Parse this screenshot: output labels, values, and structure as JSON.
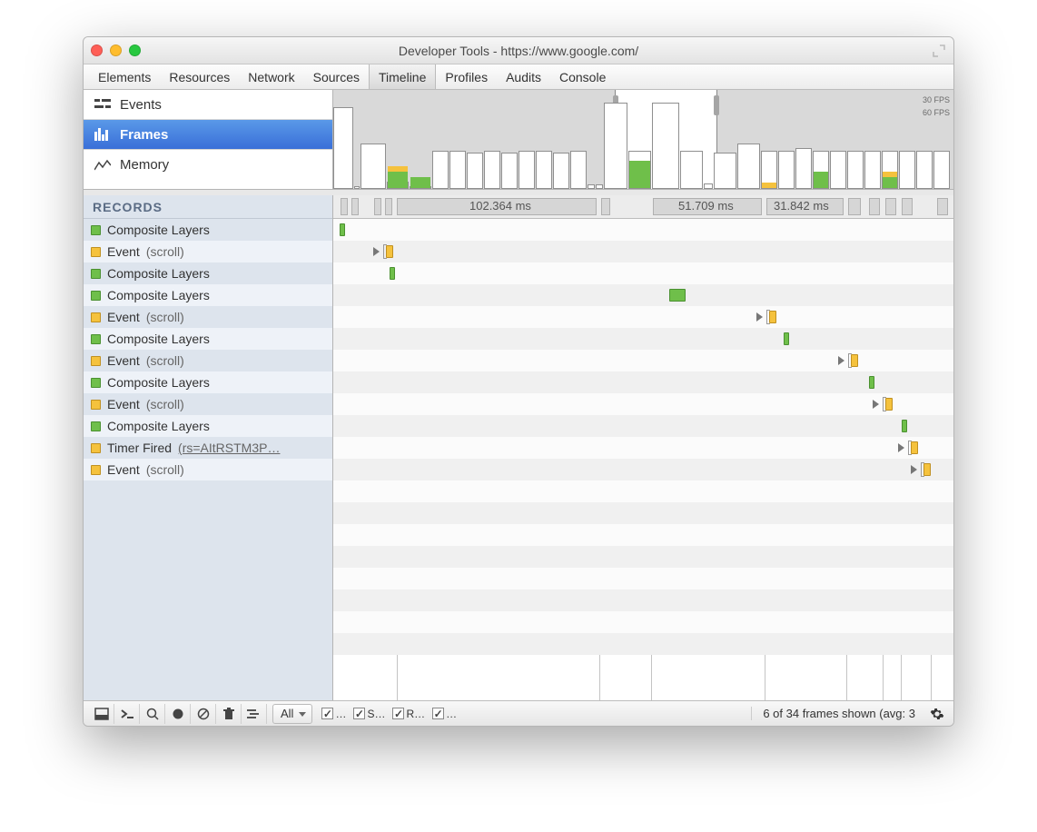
{
  "window": {
    "title": "Developer Tools - https://www.google.com/"
  },
  "tabs": [
    "Elements",
    "Resources",
    "Network",
    "Sources",
    "Timeline",
    "Profiles",
    "Audits",
    "Console"
  ],
  "active_tab": "Timeline",
  "modes": {
    "events": "Events",
    "frames": "Frames",
    "memory": "Memory"
  },
  "fps": {
    "line30": "30 FPS",
    "line60": "60 FPS"
  },
  "records_header": "RECORDS",
  "records": [
    {
      "label": "Composite Layers",
      "color": "green"
    },
    {
      "label": "Event",
      "detail": "(scroll)",
      "color": "yellow"
    },
    {
      "label": "Composite Layers",
      "color": "green"
    },
    {
      "label": "Composite Layers",
      "color": "green"
    },
    {
      "label": "Event",
      "detail": "(scroll)",
      "color": "yellow"
    },
    {
      "label": "Composite Layers",
      "color": "green"
    },
    {
      "label": "Event",
      "detail": "(scroll)",
      "color": "yellow"
    },
    {
      "label": "Composite Layers",
      "color": "green"
    },
    {
      "label": "Event",
      "detail": "(scroll)",
      "color": "yellow"
    },
    {
      "label": "Composite Layers",
      "color": "green"
    },
    {
      "label": "Timer Fired",
      "detail": "(rs=AItRSTM3P…",
      "color": "yellow",
      "underline": true
    },
    {
      "label": "Event",
      "detail": "(scroll)",
      "color": "yellow"
    }
  ],
  "frame_labels": {
    "f1": "102.364 ms",
    "f2": "51.709 ms",
    "f3": "31.842 ms"
  },
  "footer": {
    "filter": "All",
    "legend": {
      "loading": "…",
      "scripting": "S…",
      "rendering": "R…",
      "painting": "…"
    },
    "status": "6 of 34 frames shown (avg: 3"
  }
}
